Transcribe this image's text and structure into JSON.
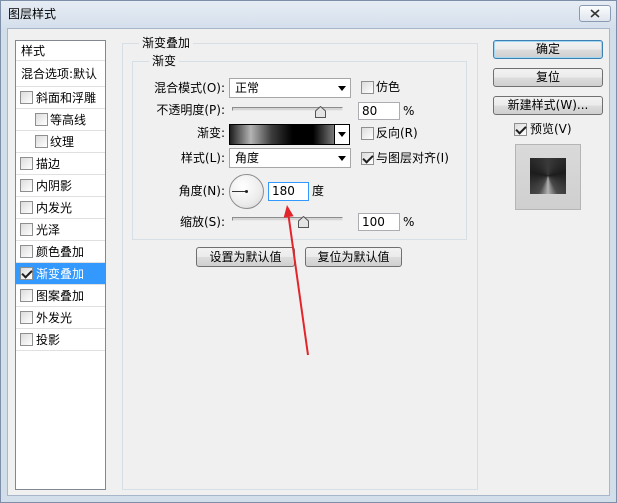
{
  "window": {
    "title": "图层样式"
  },
  "icons": {
    "close": "close-icon",
    "dropdown": "chevron-down-icon",
    "checkmark": "check-icon",
    "slider_thumb": "slider-thumb-icon",
    "angle_dial": "angle-dial-icon"
  },
  "styles_panel": {
    "header": "样式",
    "blend_options": "混合选项:默认",
    "items": [
      {
        "label": "斜面和浮雕",
        "checked": false
      },
      {
        "label": "等高线",
        "checked": false
      },
      {
        "label": "纹理",
        "checked": false
      },
      {
        "label": "描边",
        "checked": false
      },
      {
        "label": "内阴影",
        "checked": false
      },
      {
        "label": "内发光",
        "checked": false
      },
      {
        "label": "光泽",
        "checked": false
      },
      {
        "label": "颜色叠加",
        "checked": false
      },
      {
        "label": "渐变叠加",
        "checked": true,
        "selected": true
      },
      {
        "label": "图案叠加",
        "checked": false
      },
      {
        "label": "外发光",
        "checked": false
      },
      {
        "label": "投影",
        "checked": false
      }
    ]
  },
  "gradient_overlay": {
    "title": "渐变叠加",
    "gradient_group_title": "渐变",
    "blend_mode": {
      "label": "混合模式(O):",
      "value": "正常"
    },
    "dither": {
      "label": "仿色",
      "checked": false
    },
    "opacity": {
      "label": "不透明度(P):",
      "value": "80",
      "unit": "%"
    },
    "gradient": {
      "label": "渐变:",
      "stops": [
        "#1e1e1e",
        "#b4b4b4",
        "#3c3c3c",
        "#000000",
        "#000000",
        "#7a7a7a"
      ]
    },
    "reverse": {
      "label": "反向(R)",
      "checked": false
    },
    "style": {
      "label": "样式(L):",
      "value": "角度"
    },
    "align_with_layer": {
      "label": "与图层对齐(I)",
      "checked": true
    },
    "angle": {
      "label": "角度(N):",
      "value": "180",
      "unit": "度"
    },
    "scale": {
      "label": "缩放(S):",
      "value": "100",
      "unit": "%"
    },
    "buttons": {
      "make_default": "设置为默认值",
      "reset_to_default": "复位为默认值"
    }
  },
  "actions": {
    "ok": "确定",
    "reset": "复位",
    "new_style": "新建样式(W)...",
    "preview": {
      "label": "预览(V)",
      "checked": true
    }
  },
  "colors": {
    "selection": "#3399ff",
    "focus_border": "#3399ff",
    "annotation_arrow": "#e3242b"
  }
}
